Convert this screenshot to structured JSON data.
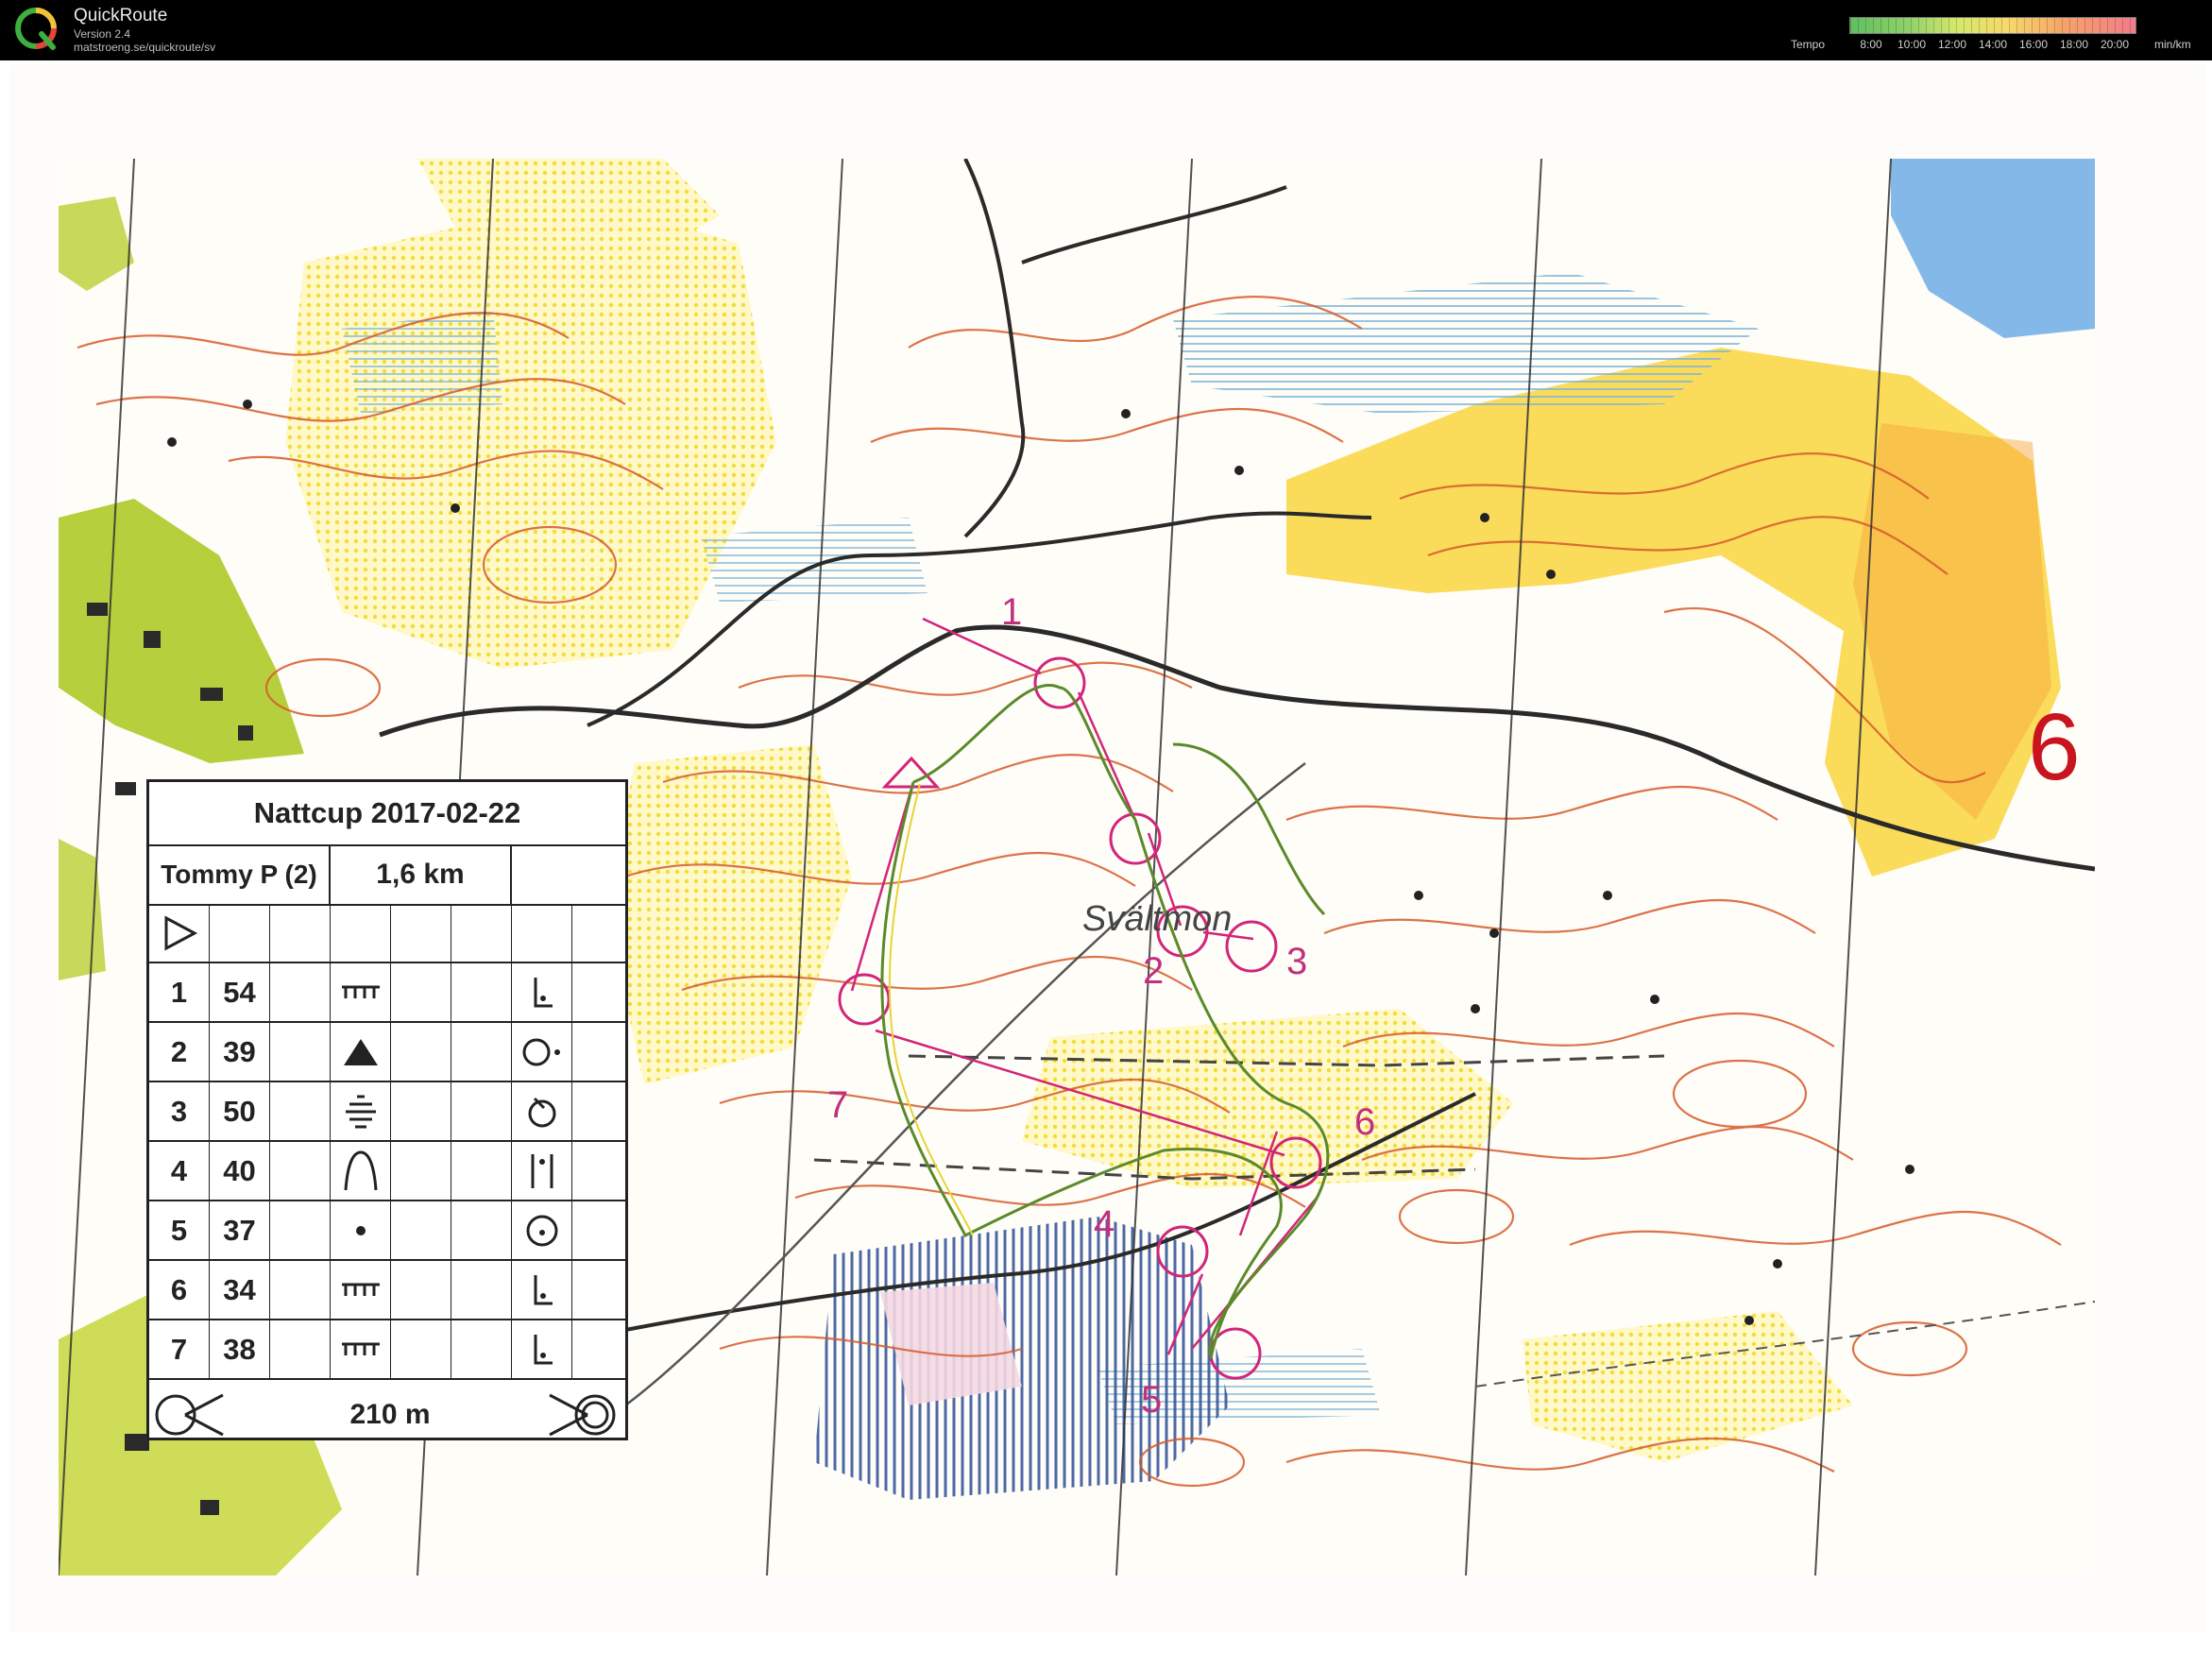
{
  "app": {
    "title": "QuickRoute",
    "version": "Version 2.4",
    "url": "matstroeng.se/quickroute/sv"
  },
  "tempo_scale": {
    "label": "Tempo",
    "ticks": [
      "8:00",
      "10:00",
      "12:00",
      "14:00",
      "16:00",
      "18:00",
      "20:00"
    ],
    "unit": "min/km",
    "colors": [
      "#5fbf5f",
      "#d6e86a",
      "#f7d96a",
      "#f5a36a",
      "#f27b8a"
    ]
  },
  "map": {
    "place_name": "Svältmon",
    "big_number": "6",
    "control_labels": [
      "1",
      "2",
      "3",
      "4",
      "5",
      "6",
      "7"
    ],
    "course_color": "#d2257a",
    "route_color": "#5a8a2a"
  },
  "control_card": {
    "title": "Nattcup 2017-02-22",
    "runner": "Tommy P (2)",
    "length": "1,6 km",
    "controls": [
      {
        "num": "1",
        "code": "54",
        "feature": "ditch-end-symbol",
        "location": "corner-symbol"
      },
      {
        "num": "2",
        "code": "39",
        "feature": "boulder-triangle-symbol",
        "location": "side-symbol"
      },
      {
        "num": "3",
        "code": "50",
        "feature": "marsh-symbol",
        "location": "part-symbol"
      },
      {
        "num": "4",
        "code": "40",
        "feature": "knoll-symbol",
        "location": "between-symbol"
      },
      {
        "num": "5",
        "code": "37",
        "feature": "small-knoll-dot-symbol",
        "location": "centre-symbol"
      },
      {
        "num": "6",
        "code": "34",
        "feature": "ditch-end-symbol",
        "location": "corner-symbol"
      },
      {
        "num": "7",
        "code": "38",
        "feature": "ditch-end-symbol",
        "location": "corner-symbol"
      }
    ],
    "finish_distance": "210 m"
  }
}
